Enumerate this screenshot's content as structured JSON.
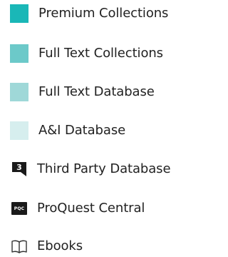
{
  "legend": {
    "items": [
      {
        "label": "Premium Collections",
        "color": "#1ab7b7"
      },
      {
        "label": "Full Text Collections",
        "color": "#6cc9c9"
      },
      {
        "label": "Full Text Database",
        "color": "#9fd8d8"
      },
      {
        "label": "A&I Database",
        "color": "#d6eeee"
      },
      {
        "label": "Third Party Database",
        "icon": "third-party-icon",
        "icon_text": "3"
      },
      {
        "label": "ProQuest Central",
        "icon": "proquest-central-icon",
        "icon_text": "PQC"
      },
      {
        "label": "Ebooks",
        "icon": "book-icon"
      }
    ]
  }
}
